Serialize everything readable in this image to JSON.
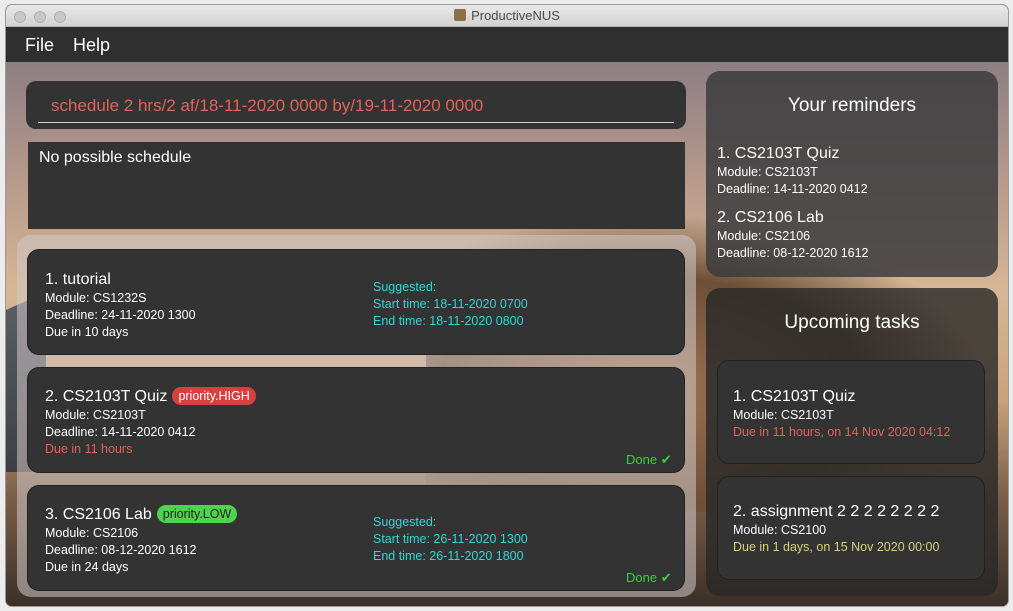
{
  "window": {
    "title": "ProductiveNUS"
  },
  "menu": {
    "file": "File",
    "help": "Help"
  },
  "command": {
    "value": "schedule 2 hrs/2 af/18-11-2020 0000 by/19-11-2020 0000"
  },
  "result": {
    "text": "No possible schedule"
  },
  "tasks": [
    {
      "title": "1.  tutorial",
      "module": "Module: CS1232S",
      "deadline": "Deadline: 24-11-2020 1300",
      "due": "Due in 10 days",
      "suggested": "Suggested:",
      "start": "Start time: 18-11-2020 0700",
      "end": "End time: 18-11-2020 0800"
    },
    {
      "title": "2.  CS2103T Quiz",
      "priority": "priority.HIGH",
      "module": "Module: CS2103T",
      "deadline": "Deadline: 14-11-2020 0412",
      "due": "Due in 11 hours",
      "done": "Done ✔"
    },
    {
      "title": "3.  CS2106 Lab",
      "priority": "priority.LOW",
      "module": "Module: CS2106",
      "deadline": "Deadline: 08-12-2020 1612",
      "due": "Due in 24 days",
      "suggested": "Suggested:",
      "start": "Start time: 26-11-2020 1300",
      "end": "End time: 26-11-2020 1800",
      "done": "Done ✔"
    }
  ],
  "reminders": {
    "heading": "Your reminders",
    "items": [
      {
        "title": "1.  CS2103T Quiz",
        "module": "Module: CS2103T",
        "deadline": "Deadline: 14-11-2020 0412"
      },
      {
        "title": "2.  CS2106 Lab",
        "module": "Module: CS2106",
        "deadline": "Deadline: 08-12-2020 1612"
      }
    ]
  },
  "upcoming": {
    "heading": "Upcoming tasks",
    "items": [
      {
        "title": "1.  CS2103T Quiz",
        "module": "Module: CS2103T",
        "due": "Due in 11 hours, on 14 Nov 2020 04:12"
      },
      {
        "title": "2.  assignment 2 2 2 2 2 2 2 2",
        "module": "Module: CS2100",
        "due": "Due in 1 days, on 15 Nov 2020 00:00"
      }
    ]
  },
  "colors": {
    "command_text": "#e0645a",
    "suggested": "#2fd7d7",
    "priority_high": "#d83f3f",
    "priority_low": "#4fd34f",
    "done": "#3ccf3c",
    "due_soon": "#e0645a",
    "due_later": "#d6d27a"
  }
}
